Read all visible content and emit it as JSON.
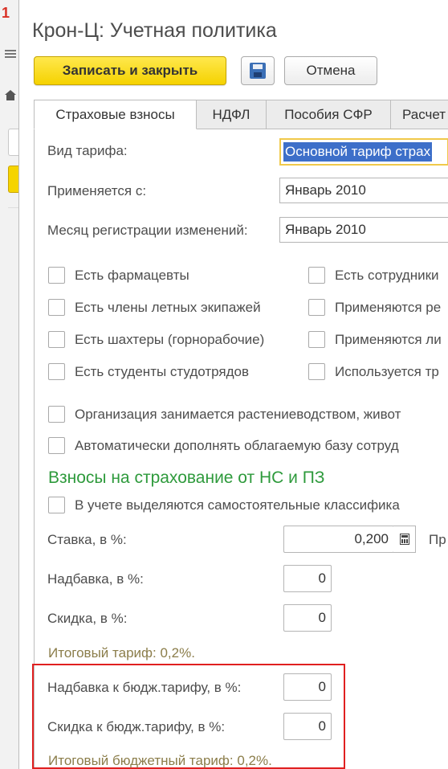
{
  "background_app": {
    "logo_text": "1"
  },
  "window": {
    "title": "Крон-Ц: Учетная политика"
  },
  "toolbar": {
    "save_close_label": "Записать и закрыть",
    "save_icon": "floppy-disk-icon",
    "cancel_label": "Отмена"
  },
  "tabs": [
    {
      "label": "Страховые взносы",
      "active": true
    },
    {
      "label": "НДФЛ",
      "active": false
    },
    {
      "label": "Пособия СФР",
      "active": false
    },
    {
      "label": "Расчет",
      "active": false
    }
  ],
  "form": {
    "tariff_type": {
      "label": "Вид тарифа:",
      "value": "Основной тариф страх"
    },
    "applied_from": {
      "label": "Применяется с:",
      "value": "Январь 2010"
    },
    "registration_month": {
      "label": "Месяц регистрации изменений:",
      "value": "Январь 2010"
    }
  },
  "checkboxes_left": [
    {
      "label": "Есть фармацевты",
      "checked": false
    },
    {
      "label": "Есть члены летных экипажей",
      "checked": false
    },
    {
      "label": "Есть шахтеры (горнорабочие)",
      "checked": false
    },
    {
      "label": "Есть студенты студотрядов",
      "checked": false
    }
  ],
  "checkboxes_right": [
    {
      "label": "Есть сотрудники",
      "checked": false
    },
    {
      "label": "Применяются ре",
      "checked": false
    },
    {
      "label": "Применяются ли",
      "checked": false
    },
    {
      "label": "Используется тр",
      "checked": false
    }
  ],
  "checkboxes_wide": [
    {
      "label": "Организация занимается растениеводством, живот",
      "checked": false
    },
    {
      "label": "Автоматически дополнять облагаемую базу сотруд",
      "checked": false
    }
  ],
  "ns_section": {
    "title": "Взносы на страхование от НС и ПЗ",
    "separate_classes": {
      "label": "В учете выделяются самостоятельные классифика",
      "checked": false
    },
    "rate": {
      "label": "Ставка, в %:",
      "value": "0,200",
      "side_label": "Пр"
    },
    "surcharge": {
      "label": "Надбавка, в %:",
      "value": "0"
    },
    "discount": {
      "label": "Скидка, в %:",
      "value": "0"
    },
    "total_tariff": "Итоговый тариф: 0,2%.",
    "budget_surcharge": {
      "label": "Надбавка к бюдж.тарифу, в %:",
      "value": "0"
    },
    "budget_discount": {
      "label": "Скидка к бюдж.тарифу, в %:",
      "value": "0"
    },
    "total_budget_tariff": "Итоговый бюджетный тариф: 0,2%."
  }
}
